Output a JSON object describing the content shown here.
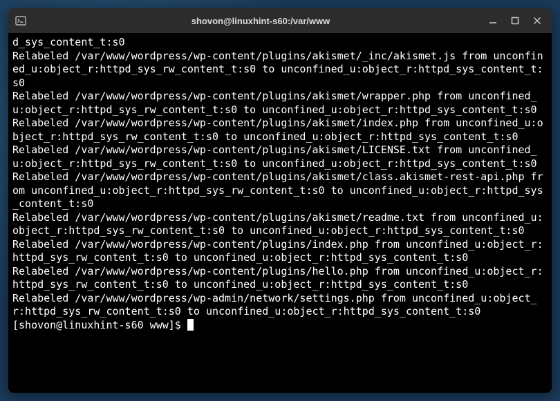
{
  "titlebar": {
    "title": "shovon@linuxhint-s60:/var/www"
  },
  "terminal": {
    "lines": [
      "d_sys_content_t:s0",
      "Relabeled /var/www/wordpress/wp-content/plugins/akismet/_inc/akismet.js from unconfined_u:object_r:httpd_sys_rw_content_t:s0 to unconfined_u:object_r:httpd_sys_content_t:s0",
      "Relabeled /var/www/wordpress/wp-content/plugins/akismet/wrapper.php from unconfined_u:object_r:httpd_sys_rw_content_t:s0 to unconfined_u:object_r:httpd_sys_content_t:s0",
      "Relabeled /var/www/wordpress/wp-content/plugins/akismet/index.php from unconfined_u:object_r:httpd_sys_rw_content_t:s0 to unconfined_u:object_r:httpd_sys_content_t:s0",
      "Relabeled /var/www/wordpress/wp-content/plugins/akismet/LICENSE.txt from unconfined_u:object_r:httpd_sys_rw_content_t:s0 to unconfined_u:object_r:httpd_sys_content_t:s0",
      "Relabeled /var/www/wordpress/wp-content/plugins/akismet/class.akismet-rest-api.php from unconfined_u:object_r:httpd_sys_rw_content_t:s0 to unconfined_u:object_r:httpd_sys_content_t:s0",
      "Relabeled /var/www/wordpress/wp-content/plugins/akismet/readme.txt from unconfined_u:object_r:httpd_sys_rw_content_t:s0 to unconfined_u:object_r:httpd_sys_content_t:s0",
      "Relabeled /var/www/wordpress/wp-content/plugins/index.php from unconfined_u:object_r:httpd_sys_rw_content_t:s0 to unconfined_u:object_r:httpd_sys_content_t:s0",
      "Relabeled /var/www/wordpress/wp-content/plugins/hello.php from unconfined_u:object_r:httpd_sys_rw_content_t:s0 to unconfined_u:object_r:httpd_sys_content_t:s0",
      "Relabeled /var/www/wordpress/wp-admin/network/settings.php from unconfined_u:object_r:httpd_sys_rw_content_t:s0 to unconfined_u:object_r:httpd_sys_content_t:s0"
    ],
    "prompt": "[shovon@linuxhint-s60 www]$ "
  }
}
